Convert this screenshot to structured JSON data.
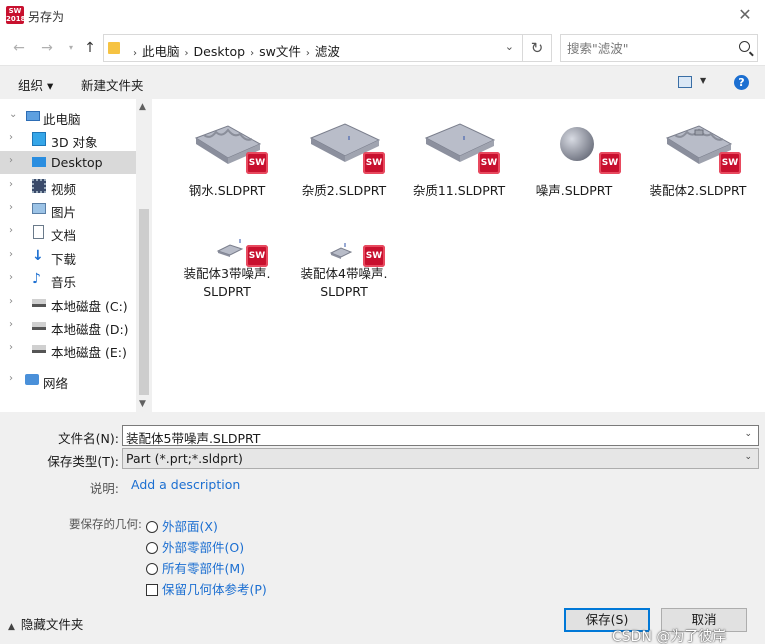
{
  "window": {
    "title": "另存为",
    "app_logo_text": "SW\n2018",
    "close_icon": "close-icon"
  },
  "navigation": {
    "breadcrumbs": [
      "此电脑",
      "Desktop",
      "sw文件",
      "滤波"
    ],
    "search_placeholder": "搜索\"滤波\""
  },
  "toolbar": {
    "organize_label": "组织 ▾",
    "new_folder_label": "新建文件夹",
    "help_label": "?"
  },
  "sidebar": {
    "items": [
      {
        "label": "此电脑",
        "icon": "computer-icon",
        "expanded": true
      },
      {
        "label": "3D 对象",
        "icon": "3d-objects-icon"
      },
      {
        "label": "Desktop",
        "icon": "desktop-icon",
        "selected": true
      },
      {
        "label": "视频",
        "icon": "video-icon"
      },
      {
        "label": "图片",
        "icon": "pictures-icon"
      },
      {
        "label": "文档",
        "icon": "documents-icon"
      },
      {
        "label": "下载",
        "icon": "download-icon"
      },
      {
        "label": "音乐",
        "icon": "music-icon"
      },
      {
        "label": "本地磁盘 (C:)",
        "icon": "drive-icon"
      },
      {
        "label": "本地磁盘 (D:)",
        "icon": "drive-icon"
      },
      {
        "label": "本地磁盘 (E:)",
        "icon": "drive-icon"
      },
      {
        "label": "网络",
        "icon": "network-icon"
      }
    ]
  },
  "files": [
    {
      "name": "钢水.SLDPRT",
      "thumb": "wavy-plate"
    },
    {
      "name": "杂质2.SLDPRT",
      "thumb": "flat-plate"
    },
    {
      "name": "杂质11.SLDPRT",
      "thumb": "flat-plate"
    },
    {
      "name": "噪声.SLDPRT",
      "thumb": "sphere"
    },
    {
      "name": "装配体2.SLDPRT",
      "thumb": "wavy-plate"
    },
    {
      "name_line1": "装配体3带噪声.",
      "name_line2": "SLDPRT",
      "thumb": "small-assembly"
    },
    {
      "name_line1": "装配体4带噪声.",
      "name_line2": "SLDPRT",
      "thumb": "small-assembly"
    }
  ],
  "sw_badge_text": "SW",
  "form": {
    "filename_label": "文件名(N):",
    "filename_value": "装配体5带噪声.SLDPRT",
    "filetype_label": "保存类型(T):",
    "filetype_value": "Part (*.prt;*.sldprt)",
    "description_label": "说明:",
    "description_link": "Add a description",
    "geometry_label": "要保存的几何:",
    "options": [
      {
        "label": "外部面(X)",
        "type": "radio"
      },
      {
        "label": "外部零部件(O)",
        "type": "radio"
      },
      {
        "label": "所有零部件(M)",
        "type": "radio"
      },
      {
        "label": "保留几何体参考(P)",
        "type": "checkbox"
      }
    ]
  },
  "footer": {
    "hide_folders_label": "隐藏文件夹",
    "save_label": "保存(S)",
    "cancel_label": "取消",
    "watermark": "CSDN @为了彼岸"
  }
}
